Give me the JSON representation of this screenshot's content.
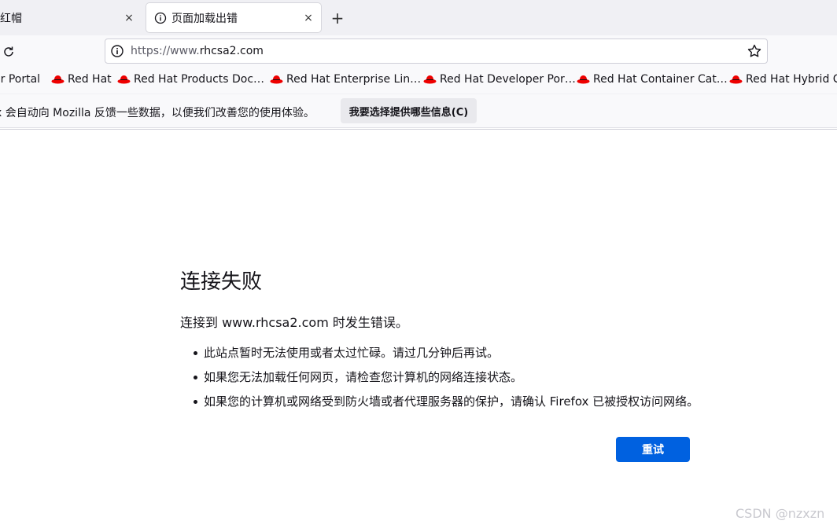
{
  "tabs": [
    {
      "title": "红帽",
      "active": false
    },
    {
      "title": "页面加载出错",
      "active": true
    }
  ],
  "tab_close_glyph": "×",
  "new_tab_glyph": "+",
  "icons": {
    "reload": "reload-icon",
    "info": "info-icon",
    "star": "bookmark-star-icon",
    "redhat": "redhat-logo-icon"
  },
  "urlbar": {
    "prefix": "https://www.",
    "domain": "rhcsa2.com"
  },
  "bookmarks": [
    {
      "label": "er Portal",
      "icon": false
    },
    {
      "label": "Red Hat",
      "icon": true
    },
    {
      "label": "Red Hat Products Doc…",
      "icon": true
    },
    {
      "label": "Red Hat Enterprise Lin…",
      "icon": true
    },
    {
      "label": "Red Hat Developer Por…",
      "icon": true
    },
    {
      "label": "Red Hat Container Cat…",
      "icon": true
    },
    {
      "label": "Red Hat Hybrid Cl",
      "icon": true
    }
  ],
  "notification": {
    "text": "x 会自动向 Mozilla 反馈一些数据，以便我们改善您的使用体验。",
    "button": "我要选择提供哪些信息(C)"
  },
  "error": {
    "title": "连接失败",
    "description": "连接到 www.rhcsa2.com 时发生错误。",
    "bullets": [
      "此站点暂时无法使用或者太过忙碌。请过几分钟后再试。",
      "如果您无法加载任何网页，请检查您计算机的网络连接状态。",
      "如果您的计算机或网络受到防火墙或者代理服务器的保护，请确认 Firefox 已被授权访问网络。"
    ],
    "retry": "重试"
  },
  "watermark": "CSDN @nzxzn",
  "colors": {
    "accent": "#0061e0",
    "redhat": "#ee0000"
  }
}
